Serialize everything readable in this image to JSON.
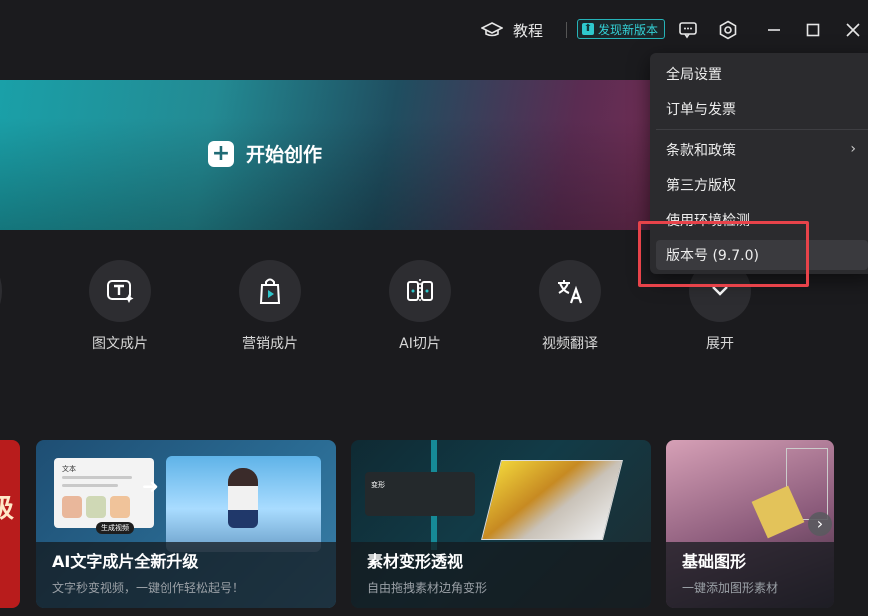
{
  "topbar": {
    "tutorial_label": "教程",
    "new_version_label": "发现新版本",
    "icons": [
      "graduation-cap-icon",
      "feedback-icon",
      "settings-icon",
      "minimize-icon",
      "maximize-icon",
      "close-icon"
    ]
  },
  "banner": {
    "start_label": "开始创作"
  },
  "tools": [
    {
      "label": "图文成片",
      "icon": "text-to-video-icon"
    },
    {
      "label": "营销成片",
      "icon": "shopping-bag-icon"
    },
    {
      "label": "AI切片",
      "icon": "clip-icon"
    },
    {
      "label": "视频翻译",
      "icon": "translate-icon"
    },
    {
      "label": "展开",
      "icon": "chevron-down-icon"
    }
  ],
  "cards": [
    {
      "title": "",
      "subtitle": "",
      "accent": "级"
    },
    {
      "title": "AI文字成片全新升级",
      "subtitle": "文字秒变视频，一键创作轻松起号！",
      "doc_label": "文本",
      "badge": "生成视频"
    },
    {
      "title": "素材变形透视",
      "subtitle": "自由拖拽素材边角变形",
      "chip": "变形"
    },
    {
      "title": "基础图形",
      "subtitle": "一键添加图形素材"
    }
  ],
  "menu": {
    "items": [
      {
        "label": "全局设置"
      },
      {
        "label": "订单与发票"
      },
      {
        "label": "条款和政策",
        "submenu": true
      },
      {
        "label": "第三方版权"
      },
      {
        "label": "使用环境检测"
      },
      {
        "label": "版本号 (9.7.0)"
      }
    ]
  },
  "colors": {
    "accent": "#26b3b8",
    "highlight": "#e8434a",
    "background": "#1b1b1e",
    "menu_bg": "#2b2b2e"
  }
}
